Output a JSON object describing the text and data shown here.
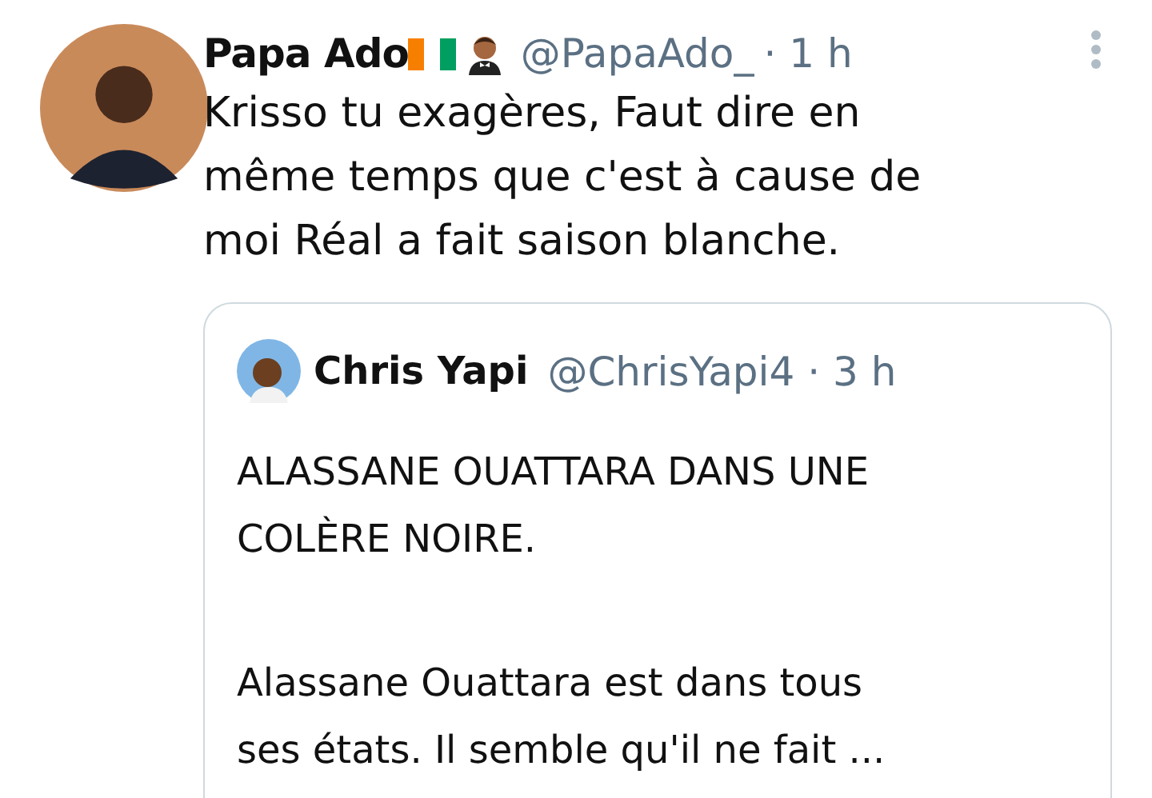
{
  "tweet": {
    "name": "Papa Ado",
    "handle": "@PapaAdo_",
    "time": "· 1 h",
    "text": "Krisso tu exagères,  Faut dire en\nmême temps que c'est à cause de\nmoi Réal a fait saison blanche."
  },
  "quoted_tweet": {
    "name": "Chris Yapi",
    "handle": "@ChrisYapi4",
    "time": "· 3 h",
    "paragraphs": [
      "ALASSANE OUATTARA DANS UNE\nCOLÈRE NOIRE.",
      "Alassane Ouattara est dans tous\nses états. Il semble qu'il ne fait ..."
    ]
  }
}
